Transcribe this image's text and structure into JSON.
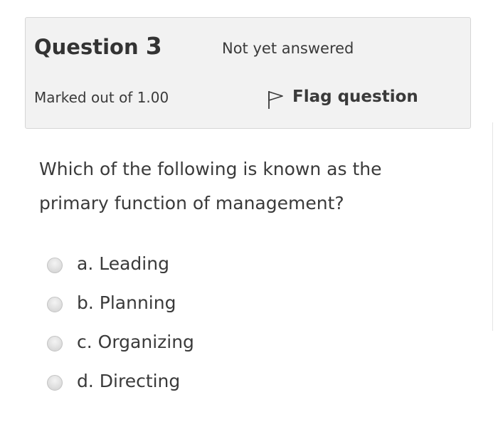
{
  "question": {
    "label": "Question",
    "number": "3",
    "state": "Not yet answered",
    "grade": "Marked out of 1.00",
    "flag_label": "Flag question",
    "flag_icon": "flag-icon",
    "text": "Which of the following is known as the primary function of management?"
  },
  "answers": [
    {
      "label": "a. Leading"
    },
    {
      "label": "b. Planning"
    },
    {
      "label": "c. Organizing"
    },
    {
      "label": "d. Directing"
    }
  ]
}
